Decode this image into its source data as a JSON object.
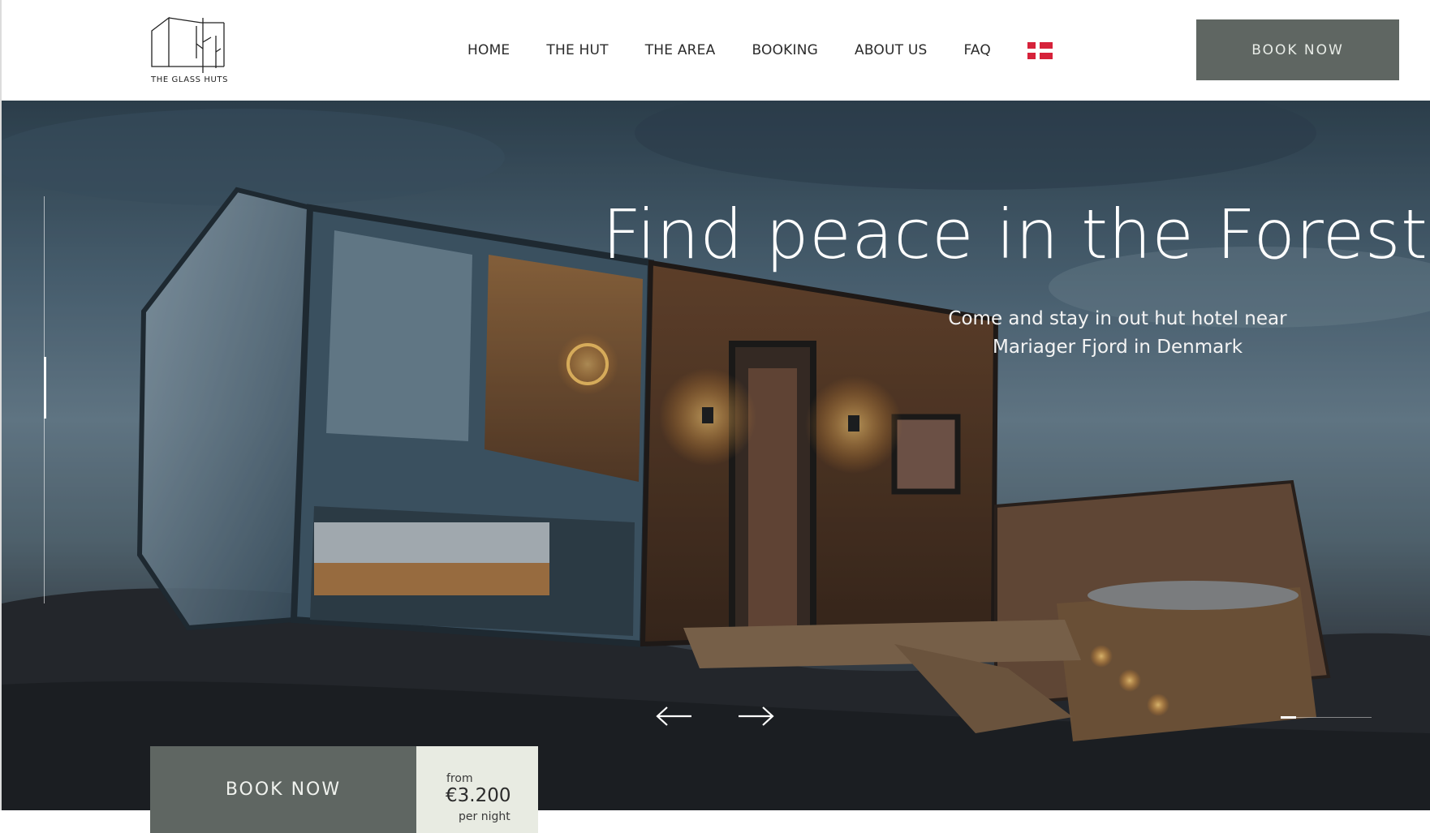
{
  "brand": {
    "name": "THE GLASS HUTS"
  },
  "nav": {
    "items": [
      "HOME",
      "THE HUT",
      "THE AREA",
      "BOOKING",
      "ABOUT US",
      "FAQ"
    ],
    "language_flag": "denmark-flag"
  },
  "header": {
    "book_label": "BOOK NOW"
  },
  "hero": {
    "title": "Find peace in the Forest",
    "subtitle": "Come and stay in out hut hotel near Mariager Fjord in Denmark",
    "slider": {
      "prev_icon": "arrow-left-icon",
      "next_icon": "arrow-right-icon",
      "progress": 0.17
    }
  },
  "booking": {
    "button_label": "BOOK NOW",
    "price_from": "from",
    "price_value": "€3.200",
    "price_unit": "per night"
  },
  "colors": {
    "accent_button": "#5f6662",
    "price_bg": "#e8ebe2",
    "flag_red": "#d6223a"
  }
}
